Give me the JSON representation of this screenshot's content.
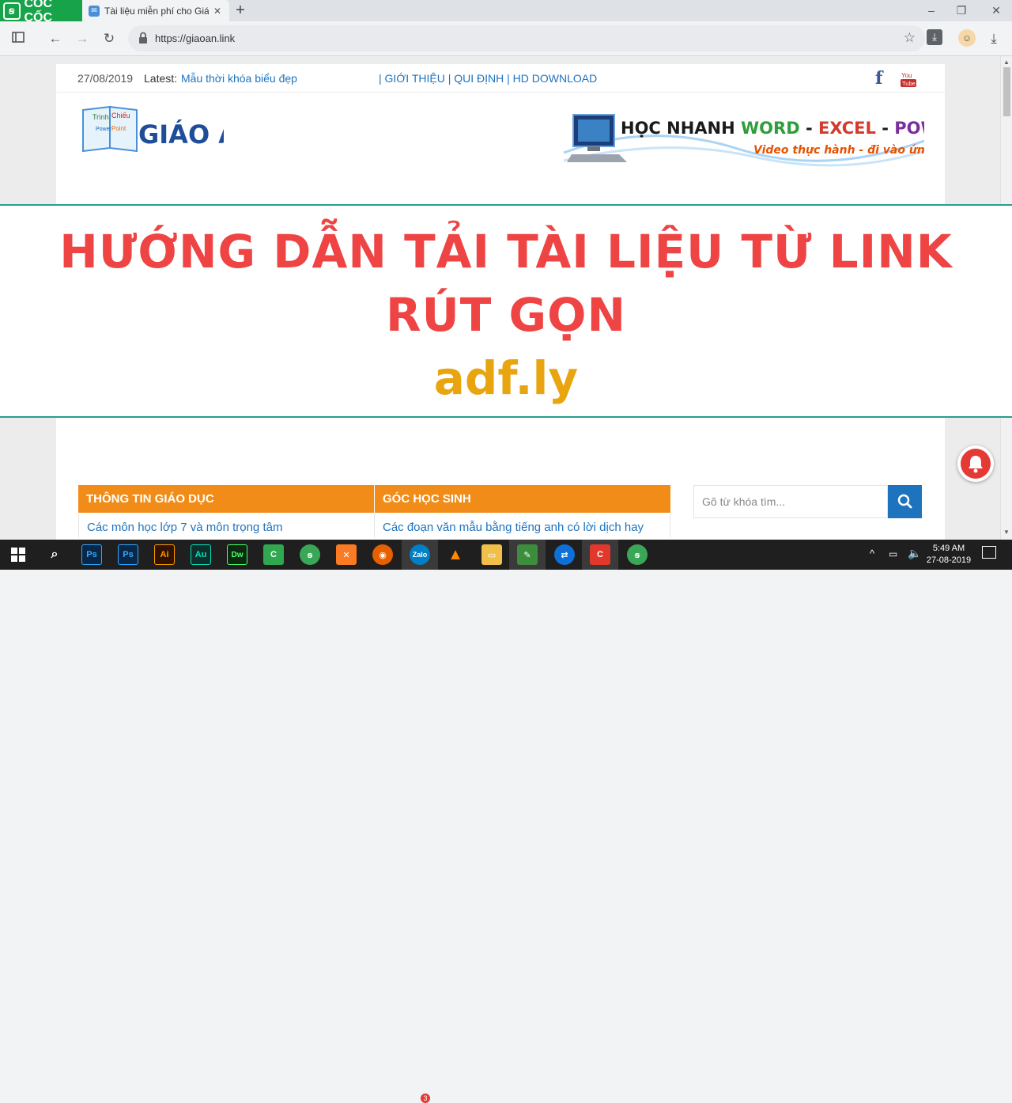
{
  "browser": {
    "brand": "CỐC CỐC",
    "tab_title": "Tài liệu miễn phí cho Giáo",
    "url": "https://giaoan.link"
  },
  "page": {
    "date": "27/08/2019",
    "latest_label": "Latest:",
    "latest_text": "Mẫu thời khóa biểu đẹp",
    "top_links": "| GIỚI THIỆU | QUI ĐỊNH | HD DOWNLOAD",
    "logo_small_text": [
      "Trình",
      "Chiếu",
      "Power",
      "Point"
    ],
    "logo_text": "GIÁO ÁN",
    "banner": {
      "word1": "HỌC NHANH ",
      "word2": "WORD",
      "sep1": " - ",
      "word3": "EXCEL",
      "sep2": " - ",
      "word4": "POWERPOINT",
      "subline": "Video thực hành - đi vào ứng dụng"
    },
    "categories": [
      {
        "heading": "THÔNG TIN GIÁO DỤC",
        "item": "Các môn học lớp 7 và môn trọng tâm"
      },
      {
        "heading": "GÓC HỌC SINH",
        "item": "Các đoạn văn mẫu bằng tiếng anh có lời dịch hay"
      }
    ],
    "search_placeholder": "Gõ từ khóa tìm..."
  },
  "overlay": {
    "line1": "HƯỚNG DẪN TẢI TÀI LIỆU TỪ LINK",
    "line2": "RÚT GỌN",
    "subtitle": "adf.ly"
  },
  "taskbar": {
    "icons": [
      "windows-start",
      "search",
      "photoshop",
      "photoshop",
      "illustrator",
      "audition",
      "dreamweaver",
      "camtasia",
      "coccoc",
      "xampp",
      "firefox",
      "zalo",
      "vlc",
      "file-explorer",
      "notepad",
      "teamviewer",
      "camtasia-recorder",
      "coccoc"
    ],
    "zalo_badge": "3",
    "time": "5:49 AM",
    "date": "27-08-2019"
  },
  "colors": {
    "headline": "#ef4444",
    "subtitle": "#e8a50f",
    "category_bg": "#f28c18",
    "link": "#1e73be"
  }
}
